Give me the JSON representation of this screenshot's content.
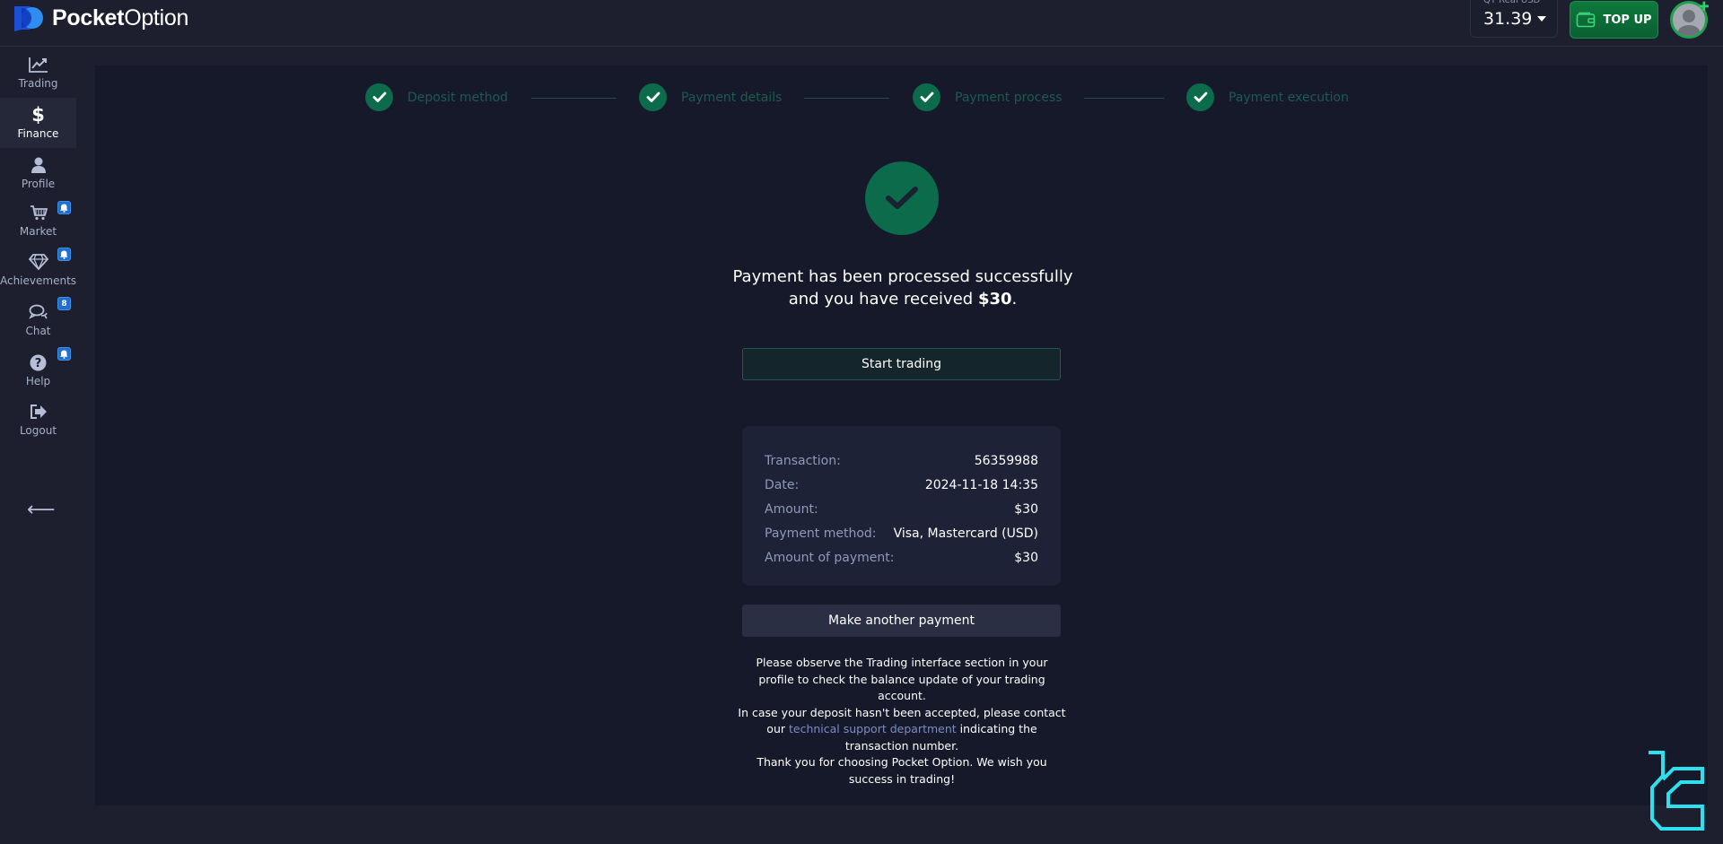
{
  "header": {
    "brand_bold": "Pocket",
    "brand_light": "Option",
    "account_label": "QT Real  USD",
    "balance": "31.39",
    "topup_label": "TOP UP"
  },
  "sidebar": {
    "items": [
      {
        "label": "Trading",
        "icon": "chart-line-icon",
        "active": false
      },
      {
        "label": "Finance",
        "icon": "dollar-icon",
        "active": true
      },
      {
        "label": "Profile",
        "icon": "user-icon",
        "active": false
      },
      {
        "label": "Market",
        "icon": "cart-icon",
        "active": false,
        "badge": "bell"
      },
      {
        "label": "Achievements",
        "icon": "diamond-icon",
        "active": false,
        "badge": "bell"
      },
      {
        "label": "Chat",
        "icon": "chat-icon",
        "active": false,
        "badge": "8"
      },
      {
        "label": "Help",
        "icon": "question-icon",
        "active": false,
        "badge": "bell"
      },
      {
        "label": "Logout",
        "icon": "logout-icon",
        "active": false
      }
    ],
    "chat_badge": "8"
  },
  "steps": [
    {
      "label": "Deposit method",
      "done": true
    },
    {
      "label": "Payment details",
      "done": true
    },
    {
      "label": "Payment process",
      "done": true
    },
    {
      "label": "Payment execution",
      "done": true
    }
  ],
  "result": {
    "message_line1": "Payment has been processed successfully",
    "message_line2_prefix": "and you have received ",
    "message_amount": "$30",
    "message_suffix": ".",
    "start_trading_label": "Start trading",
    "make_another_label": "Make another payment"
  },
  "details": [
    {
      "key": "Transaction:",
      "value": "56359988"
    },
    {
      "key": "Date:",
      "value": "2024-11-18 14:35"
    },
    {
      "key": "Amount:",
      "value": "$30"
    },
    {
      "key": "Payment method:",
      "value": "Visa, Mastercard (USD)"
    },
    {
      "key": "Amount of payment:",
      "value": "$30"
    }
  ],
  "info": {
    "para1": "Please observe the Trading interface section in your profile to check the balance update of your trading account.",
    "para2_prefix": "In case your deposit hasn't been accepted, please contact our ",
    "para2_link": "technical support department",
    "para2_suffix": " indicating the transaction number.",
    "para3": "Thank you for choosing Pocket Option. We wish you success in trading!"
  },
  "colors": {
    "accent_green": "#0b6b4b",
    "topup_green": "#0e7a3a",
    "badge_blue": "#1e6fd0",
    "link_color": "#7a8dc4",
    "watermark_cyan": "#2de0f0"
  }
}
